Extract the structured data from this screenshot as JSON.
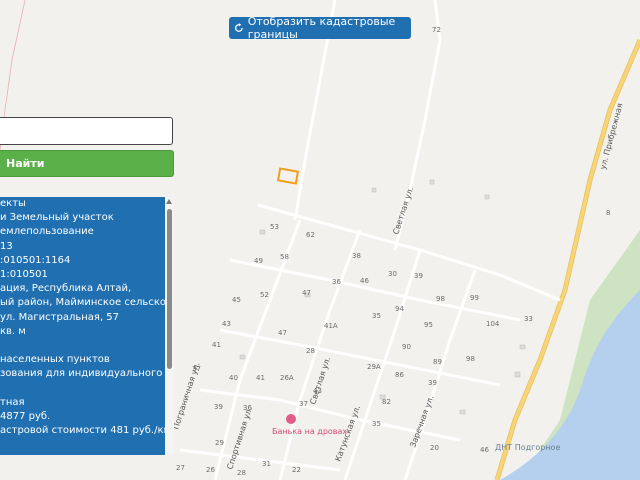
{
  "toolbar": {
    "cadastral_label": "Отобразить кадастровые границы"
  },
  "search": {
    "value": "",
    "find_label": "Найти"
  },
  "info_panel": {
    "rows": [
      [
        "екты",
        ""
      ],
      [
        "и",
        " Земельный участок"
      ],
      [
        "",
        "емлепользование"
      ],
      [
        "13",
        ""
      ],
      [
        ":010501:1164",
        ""
      ],
      [
        "1:010501",
        ""
      ],
      [
        "ация, Республика Алтай,",
        ""
      ],
      [
        "ый район, Майминское сельское",
        ""
      ],
      [
        "ул. Магистральная, 57",
        ""
      ],
      [
        "кв. м",
        ""
      ],
      [
        "",
        ""
      ],
      [
        "",
        "населенных пунктов"
      ],
      [
        "зования",
        " для индивидуального"
      ],
      [
        "",
        ""
      ],
      [
        "",
        "тная"
      ],
      [
        "4877 руб.",
        ""
      ],
      [
        "астровой стоимости ",
        "481 руб./кв."
      ]
    ]
  },
  "map": {
    "streets": [
      "ул. Прибрежная",
      "Светлая ул.",
      "Спортивная ул.",
      "Светлая ул.",
      "Катунская ул.",
      "Заречная ул.",
      "Пограничная ул."
    ],
    "house_numbers": [
      "72",
      "8",
      "53",
      "62",
      "49",
      "58",
      "38",
      "30",
      "39",
      "98",
      "99",
      "33",
      "45",
      "52",
      "47",
      "36",
      "46",
      "35",
      "94",
      "95",
      "104",
      "43",
      "41А",
      "47",
      "90",
      "89",
      "98",
      "41",
      "28",
      "29А",
      "86",
      "39",
      "37",
      "40",
      "41",
      "26А",
      "43",
      "82",
      "39",
      "36",
      "37",
      "35",
      "29",
      "31",
      "27",
      "26",
      "28",
      "22",
      "46",
      "20"
    ],
    "pois": [
      "Банька на дровах",
      "ДНТ Подгорное"
    ],
    "colors": {
      "water": "#b5d0ee",
      "forest": "#cde3c1",
      "road": "#f6d47a",
      "button": "#1f6fb1",
      "find": "#5cb04a",
      "parcel": "#f39c1d"
    }
  }
}
